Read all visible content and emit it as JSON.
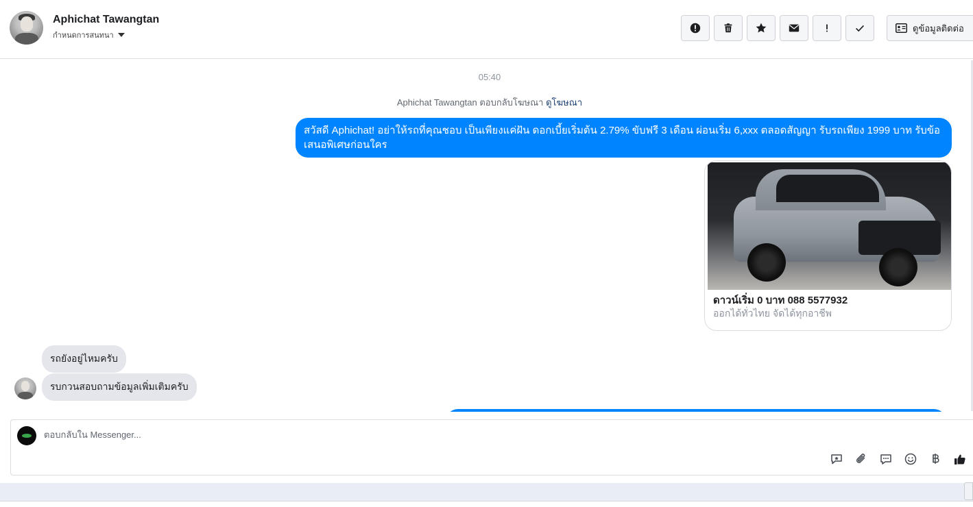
{
  "header": {
    "contact_name": "Aphichat Tawangtan",
    "assign_label": "กำหนดการสนทนา",
    "actions": [
      {
        "name": "spam-button",
        "icon": "alert-circle-icon"
      },
      {
        "name": "delete-button",
        "icon": "trash-icon"
      },
      {
        "name": "star-button",
        "icon": "star-icon"
      },
      {
        "name": "unread-button",
        "icon": "envelope-icon"
      },
      {
        "name": "follow-up-button",
        "icon": "exclamation-icon"
      },
      {
        "name": "mark-done-button",
        "icon": "check-icon"
      }
    ],
    "contact_info_label": "ดูข้อมูลติดต่อ"
  },
  "conversation": {
    "timestamp": "05:40",
    "ad_reply_text": "Aphichat Tawangtan ตอบกลับโฆษณา",
    "ad_link": "ดูโฆษณา",
    "outgoing_message": "สวัสดี Aphichat! อย่าให้รถที่คุณชอบ เป็นเพียงแค่ฝัน ดอกเบี้ยเริ่มต้น 2.79% ขับฟรี 3 เดือน ผ่อนเริ่ม 6,xxx ตลอดสัญญา รับรถเพียง 1999 บาท รับข้อเสนอพิเศษก่อนใคร",
    "card": {
      "title": "ดาวน์เริ่ม 0 บาท 088 5577932",
      "subtitle": "ออกได้ทั่วไทย จัดได้ทุกอาชีพ"
    },
    "incoming_messages": [
      "รถยังอยู่ไหมครับ",
      "รบกวนสอบถามข้อมูลเพิ่มเติมครับ"
    ]
  },
  "composer": {
    "placeholder": "ตอบกลับใน Messenger...",
    "tools": [
      "saved-reply-icon",
      "paperclip-icon",
      "chat-bubble-icon",
      "emoji-icon",
      "baht-icon",
      "thumbs-up-icon"
    ]
  },
  "colors": {
    "outgoing_bubble": "#0084ff",
    "incoming_bubble": "#e4e6eb",
    "link": "#1c3f70"
  }
}
